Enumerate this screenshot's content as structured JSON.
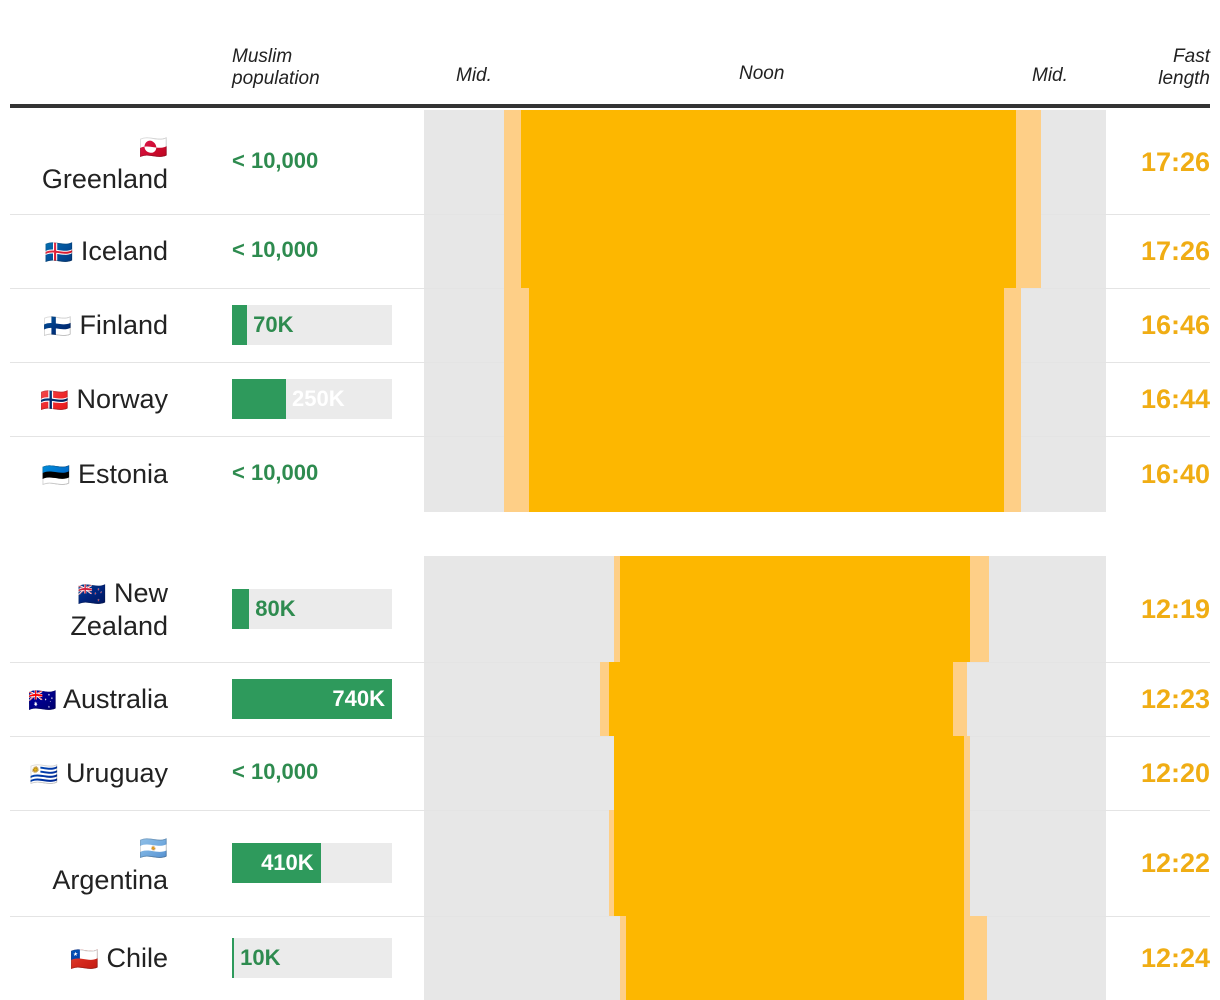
{
  "header": {
    "muslim_population": [
      "Muslim",
      "population"
    ],
    "mid_left": "Mid.",
    "noon": "Noon",
    "mid_right": "Mid.",
    "fast_length": [
      "Fast",
      "length"
    ]
  },
  "colors": {
    "population_green": "#2e9a5c",
    "population_text_green": "#2e8b4f",
    "fast_dark": "#fdb700",
    "fast_light": "#fecf87",
    "fast_text": "#f0ad14",
    "background_band": "#e7e7e7"
  },
  "chart_data": {
    "type": "table",
    "x_axis": {
      "start": "00:00",
      "center": "12:00",
      "end": "24:00"
    },
    "population_scale_max": 740000,
    "groups": [
      {
        "rows": [
          {
            "country": "Greenland",
            "flag": "🇬🇱",
            "population_label": "< 10,000",
            "population": null,
            "fast_start": "03:24",
            "fast_end": "20:50",
            "twilight_start": "02:48",
            "twilight_end": "21:42",
            "fast_length": "17:26"
          },
          {
            "country": "Iceland",
            "flag": "🇮🇸",
            "population_label": "< 10,000",
            "population": null,
            "fast_start": "03:24",
            "fast_end": "20:50",
            "twilight_start": "02:48",
            "twilight_end": "21:42",
            "fast_length": "17:26"
          },
          {
            "country": "Finland",
            "flag": "🇫🇮",
            "population_label": "70K",
            "population": 70000,
            "fast_start": "03:42",
            "fast_end": "20:24",
            "twilight_start": "02:48",
            "twilight_end": "21:00",
            "fast_length": "16:46"
          },
          {
            "country": "Norway",
            "flag": "🇳🇴",
            "population_label": "250K",
            "population": 250000,
            "fast_start": "03:42",
            "fast_end": "20:24",
            "twilight_start": "02:48",
            "twilight_end": "21:00",
            "fast_length": "16:44"
          },
          {
            "country": "Estonia",
            "flag": "🇪🇪",
            "population_label": "< 10,000",
            "population": null,
            "fast_start": "03:42",
            "fast_end": "20:24",
            "twilight_start": "02:48",
            "twilight_end": "21:00",
            "fast_length": "16:40"
          }
        ]
      },
      {
        "rows": [
          {
            "country": "New Zealand",
            "flag": "🇳🇿",
            "population_label": "80K",
            "population": 80000,
            "fast_start": "06:54",
            "fast_end": "19:12",
            "twilight_start": "06:42",
            "twilight_end": "19:54",
            "fast_length": "12:19"
          },
          {
            "country": "Australia",
            "flag": "🇦🇺",
            "population_label": "740K",
            "population": 740000,
            "fast_start": "06:30",
            "fast_end": "18:36",
            "twilight_start": "06:12",
            "twilight_end": "19:06",
            "fast_length": "12:23"
          },
          {
            "country": "Uruguay",
            "flag": "🇺🇾",
            "population_label": "< 10,000",
            "population": null,
            "fast_start": "06:42",
            "fast_end": "19:00",
            "twilight_start": "06:42",
            "twilight_end": "19:12",
            "fast_length": "12:20"
          },
          {
            "country": "Argentina",
            "flag": "🇦🇷",
            "population_label": "410K",
            "population": 410000,
            "fast_start": "06:42",
            "fast_end": "19:00",
            "twilight_start": "06:30",
            "twilight_end": "19:12",
            "fast_length": "12:22"
          },
          {
            "country": "Chile",
            "flag": "🇨🇱",
            "population_label": "10K",
            "population": 10000,
            "fast_start": "07:06",
            "fast_end": "19:00",
            "twilight_start": "06:54",
            "twilight_end": "19:48",
            "fast_length": "12:24"
          }
        ]
      }
    ]
  }
}
